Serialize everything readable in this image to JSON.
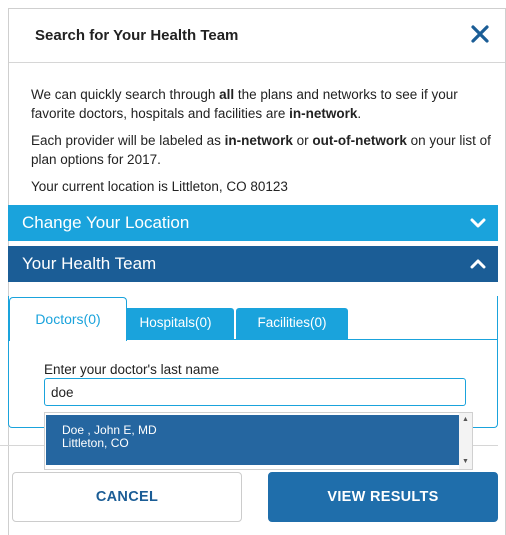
{
  "modal": {
    "title": "Search for Your Health Team",
    "close_icon": "close-icon"
  },
  "intro": {
    "p1_a": "We can quickly search through ",
    "p1_b": "all",
    "p1_c": " the plans and networks to see if your favorite doctors, hospitals and facilities are ",
    "p1_d": "in-network",
    "p1_e": ".",
    "p2_a": "Each provider will be labeled as ",
    "p2_b": "in-network",
    "p2_c": " or ",
    "p2_d": "out-of-network",
    "p2_e": " on your list of plan options for 2017.",
    "p3": "Your current location is Littleton, CO 80123"
  },
  "accordions": {
    "location": {
      "label": "Change Your Location",
      "icon": "chevron-down-icon",
      "color": "#1aa3dc"
    },
    "team": {
      "label": "Your Health Team",
      "icon": "chevron-up-icon",
      "color": "#1b5d96"
    }
  },
  "tabs": [
    {
      "label": "Doctors(0)",
      "active": true
    },
    {
      "label": "Hospitals(0)",
      "active": false
    },
    {
      "label": "Facilities(0)",
      "active": false
    }
  ],
  "search": {
    "label": "Enter your doctor's last name",
    "value": "doe"
  },
  "suggestions": [
    {
      "name": "Doe , John E, MD",
      "location": "Littleton, CO"
    }
  ],
  "footer": {
    "cancel_label": "CANCEL",
    "results_label": "VIEW RESULTS"
  },
  "colors": {
    "accent": "#1aa3dc",
    "primary": "#1b5d96",
    "button": "#1f6eab"
  }
}
